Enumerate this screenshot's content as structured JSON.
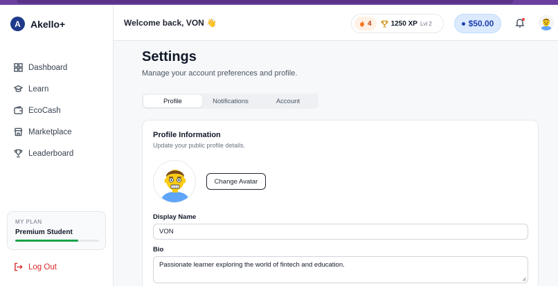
{
  "app": {
    "name": "Akello+",
    "logo_letter": "A"
  },
  "sidebar": {
    "items": [
      {
        "label": "Dashboard",
        "icon": "grid-icon"
      },
      {
        "label": "Learn",
        "icon": "graduation-cap-icon"
      },
      {
        "label": "EcoCash",
        "icon": "wallet-icon"
      },
      {
        "label": "Marketplace",
        "icon": "store-icon"
      },
      {
        "label": "Leaderboard",
        "icon": "trophy-icon"
      }
    ],
    "plan": {
      "label": "MY PLAN",
      "name": "Premium Student",
      "progress": 0.75
    },
    "logout_label": "Log Out"
  },
  "header": {
    "welcome": "Welcome back, VON 👋",
    "streak": "4",
    "xp": "1250 XP",
    "level": "Lvl 2",
    "balance": "$50.00"
  },
  "settings": {
    "title": "Settings",
    "subtitle": "Manage your account preferences and profile.",
    "tabs": [
      "Profile",
      "Notifications",
      "Account"
    ],
    "active_tab": "Profile"
  },
  "profile": {
    "title": "Profile Information",
    "subtitle": "Update your public profile details.",
    "change_avatar_label": "Change Avatar",
    "display_name_label": "Display Name",
    "display_name_value": "VON",
    "bio_label": "Bio",
    "bio_value": "Passionate learner exploring the world of fintech and education."
  },
  "colors": {
    "brand": "#1e3a8a",
    "accent_purple": "#6b3fa0",
    "progress_green": "#16a34a",
    "logout_red": "#dc2626",
    "balance_bg": "#dbeafe"
  }
}
